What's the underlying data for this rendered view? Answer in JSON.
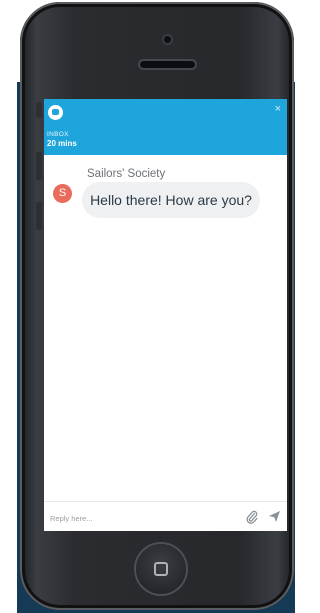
{
  "widget": {
    "inbox_label": "INBOX",
    "time_ago": "20 mins",
    "close_glyph": "×"
  },
  "conversation": {
    "sender_name": "Sailors' Society",
    "avatar_initial": "S",
    "message": "Hello there! How are you?"
  },
  "composer": {
    "placeholder": "Reply here..."
  },
  "icons": [
    "chat-logo-icon",
    "close-icon",
    "attachment-icon",
    "send-icon"
  ],
  "colors": {
    "header": "#1ea6dc",
    "avatar": "#e86b5c",
    "bubble": "#eef0f2",
    "backdrop": "#143a55"
  }
}
